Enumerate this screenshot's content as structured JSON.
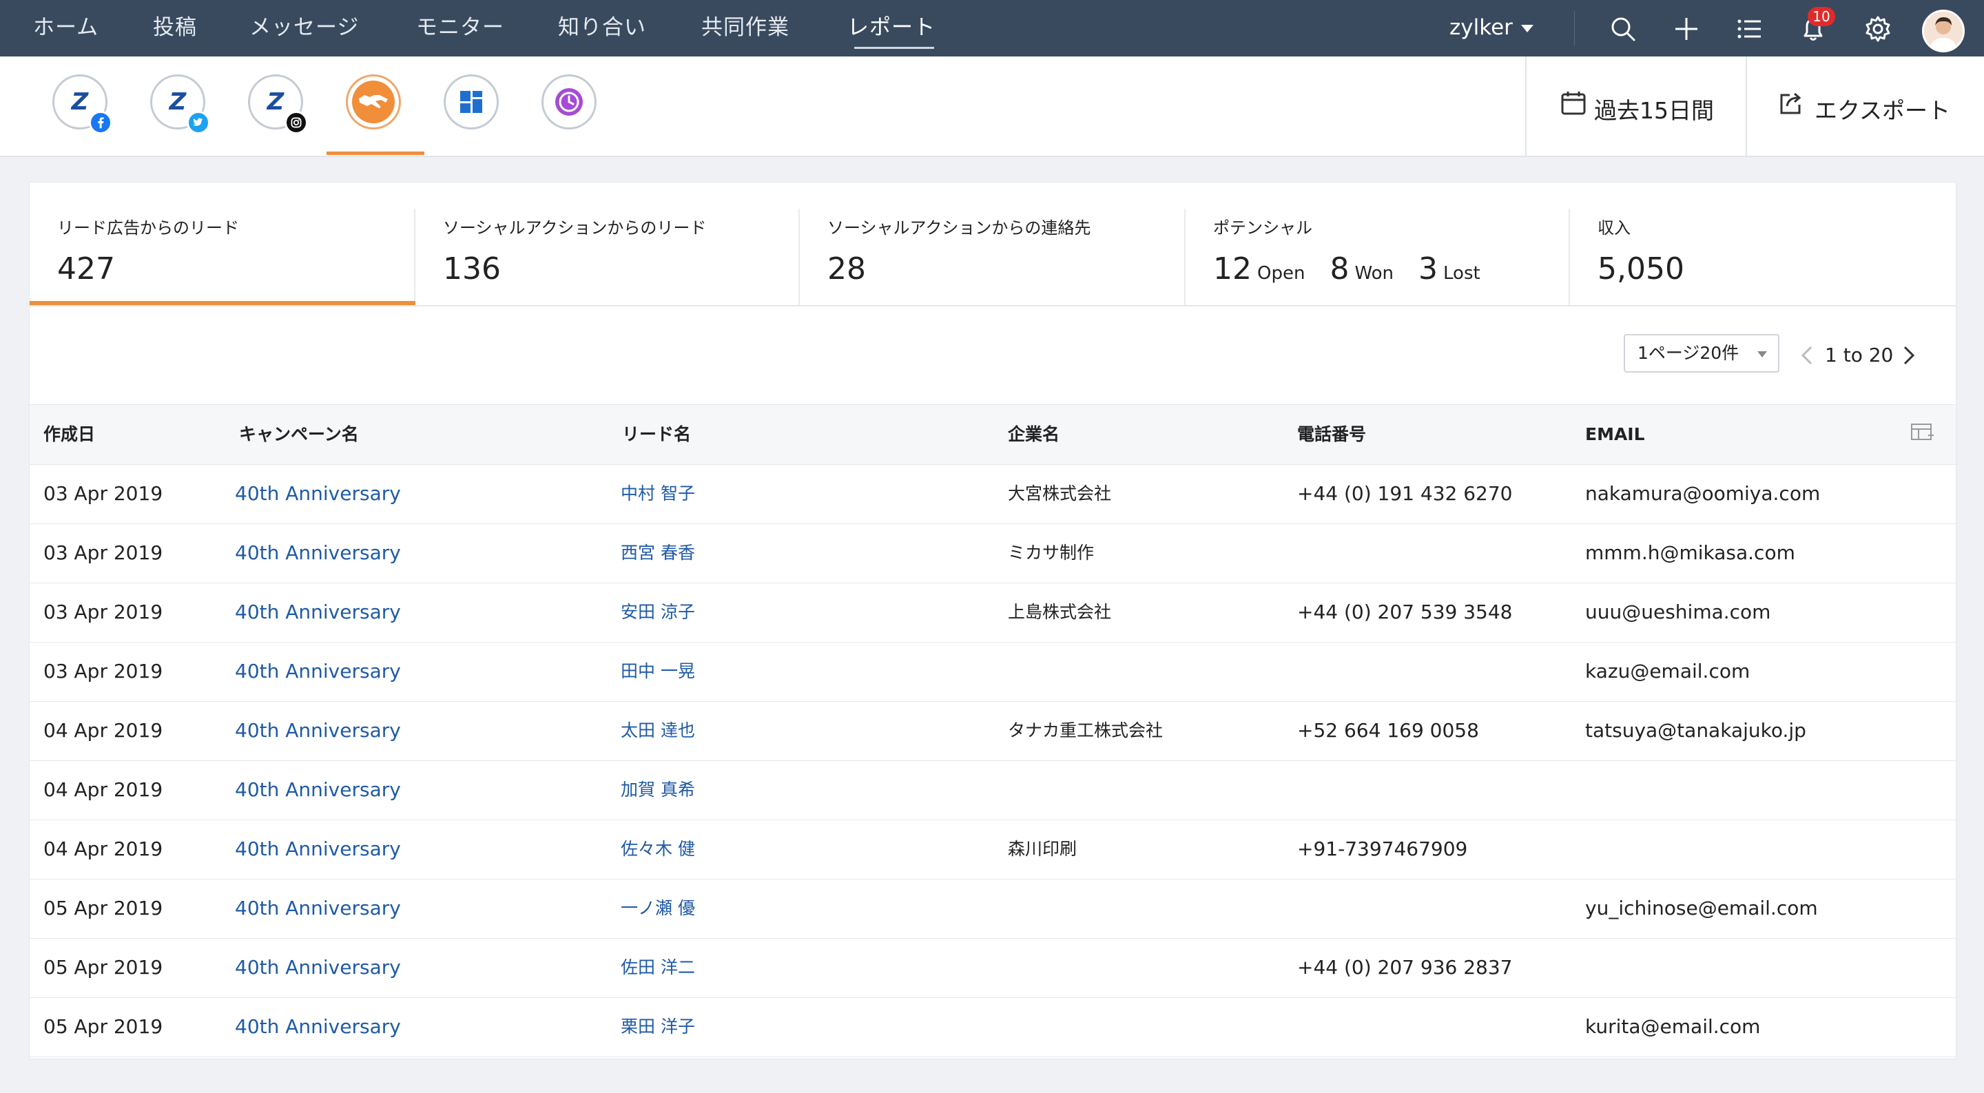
{
  "nav": {
    "items": [
      "ホーム",
      "投稿",
      "メッセージ",
      "モニター",
      "知り合い",
      "共同作業",
      "レポート"
    ],
    "active_index": 6,
    "brand": "zylker",
    "notification_count": "10",
    "icons": [
      "search-icon",
      "plus-icon",
      "list-icon",
      "bell-icon",
      "gear-icon",
      "avatar"
    ]
  },
  "toolbar": {
    "channels": [
      {
        "name": "zylker-facebook",
        "badge": "facebook-icon"
      },
      {
        "name": "zylker-twitter",
        "badge": "twitter-icon"
      },
      {
        "name": "zylker-instagram",
        "badge": "instagram-icon"
      },
      {
        "name": "handshake",
        "badge": ""
      },
      {
        "name": "dashboard-grid",
        "badge": ""
      },
      {
        "name": "clock-report",
        "badge": ""
      }
    ],
    "active_channel": 3,
    "date_range": "過去15日間",
    "export_label": "エクスポート"
  },
  "stats": {
    "leads_ads": {
      "label": "リード広告からのリード",
      "value": "427"
    },
    "leads_social": {
      "label": "ソーシャルアクションからのリード",
      "value": "136"
    },
    "contacts_social": {
      "label": "ソーシャルアクションからの連絡先",
      "value": "28"
    },
    "potential": {
      "label": "ポテンシャル",
      "open_count": "12",
      "open_label": "Open",
      "won_count": "8",
      "won_label": "Won",
      "lost_count": "3",
      "lost_label": "Lost"
    },
    "revenue": {
      "label": "収入",
      "value": "5,050"
    }
  },
  "pagination": {
    "per_page": "1ページ20件",
    "range": "1 to 20"
  },
  "table": {
    "headers": {
      "created": "作成日",
      "campaign": "キャンペーン名",
      "lead": "リード名",
      "company": "企業名",
      "phone": "電話番号",
      "email": "EMAIL"
    },
    "rows": [
      {
        "created": "03 Apr 2019",
        "campaign": "40th Anniversary",
        "lead": "中村 智子",
        "company": "大宮株式会社",
        "phone": "+44 (0) 191 432 6270",
        "email": "nakamura@oomiya.com"
      },
      {
        "created": "03 Apr 2019",
        "campaign": "40th Anniversary",
        "lead": "西宮 春香",
        "company": "ミカサ制作",
        "phone": "",
        "email": "mmm.h@mikasa.com"
      },
      {
        "created": "03 Apr 2019",
        "campaign": "40th Anniversary",
        "lead": "安田 涼子",
        "company": "上島株式会社",
        "phone": "+44 (0) 207 539 3548",
        "email": "uuu@ueshima.com"
      },
      {
        "created": "03 Apr 2019",
        "campaign": "40th Anniversary",
        "lead": "田中 一晃",
        "company": "",
        "phone": "",
        "email": "kazu@email.com"
      },
      {
        "created": "04 Apr 2019",
        "campaign": "40th Anniversary",
        "lead": "太田 達也",
        "company": "タナカ重工株式会社",
        "phone": "+52 664 169 0058",
        "email": "tatsuya@tanakajuko.jp"
      },
      {
        "created": "04 Apr 2019",
        "campaign": "40th Anniversary",
        "lead": "加賀 真希",
        "company": "",
        "phone": "",
        "email": ""
      },
      {
        "created": "04 Apr 2019",
        "campaign": "40th Anniversary",
        "lead": "佐々木 健",
        "company": "森川印刷",
        "phone": "+91-7397467909",
        "email": ""
      },
      {
        "created": "05 Apr 2019",
        "campaign": "40th Anniversary",
        "lead": "一ノ瀬 優",
        "company": "",
        "phone": "",
        "email": "yu_ichinose@email.com"
      },
      {
        "created": "05 Apr 2019",
        "campaign": "40th Anniversary",
        "lead": "佐田 洋二",
        "company": "",
        "phone": "+44 (0) 207 936 2837",
        "email": ""
      },
      {
        "created": "05 Apr 2019",
        "campaign": "40th Anniversary",
        "lead": "栗田 洋子",
        "company": "",
        "phone": "",
        "email": "kurita@email.com"
      }
    ]
  }
}
